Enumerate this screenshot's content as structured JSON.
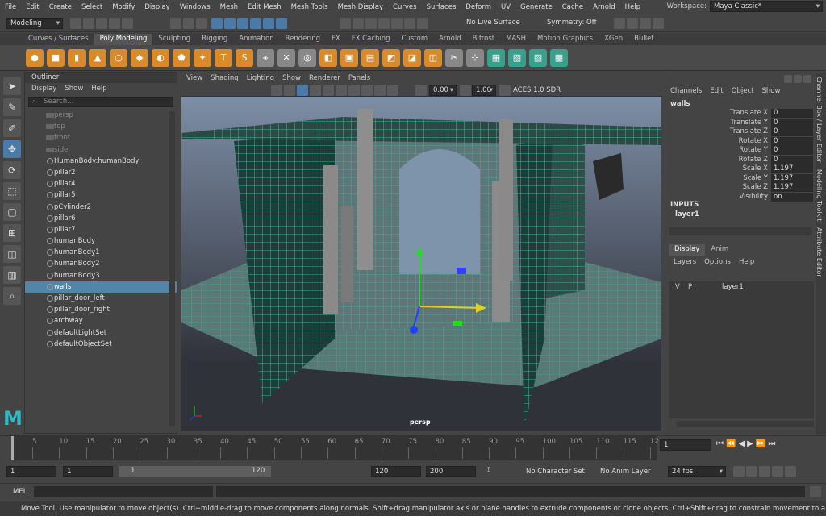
{
  "menubar": {
    "items": [
      "File",
      "Edit",
      "Create",
      "Select",
      "Modify",
      "Display",
      "Windows",
      "Mesh",
      "Edit Mesh",
      "Mesh Tools",
      "Mesh Display",
      "Curves",
      "Surfaces",
      "Deform",
      "UV",
      "Generate",
      "Cache",
      "Arnold",
      "Help"
    ],
    "workspace_label": "Workspace:",
    "workspace_value": "Maya Classic*"
  },
  "statusline": {
    "mode": "Modeling",
    "live_surface": "No Live Surface",
    "symmetry": "Symmetry: Off"
  },
  "shelf": {
    "tabs": [
      "Curves / Surfaces",
      "Poly Modeling",
      "Sculpting",
      "Rigging",
      "Animation",
      "Rendering",
      "FX",
      "FX Caching",
      "Custom",
      "Arnold",
      "Bifrost",
      "MASH",
      "Motion Graphics",
      "XGen",
      "Bullet"
    ],
    "active": "Poly Modeling"
  },
  "outliner": {
    "title": "Outliner",
    "menus": [
      "Display",
      "Show",
      "Help"
    ],
    "search_placeholder": "Search...",
    "items": [
      {
        "label": "persp",
        "type": "camera",
        "dim": true
      },
      {
        "label": "top",
        "type": "camera",
        "dim": true
      },
      {
        "label": "front",
        "type": "camera",
        "dim": true
      },
      {
        "label": "side",
        "type": "camera",
        "dim": true
      },
      {
        "label": "HumanBody:humanBody",
        "type": "mesh"
      },
      {
        "label": "pillar2",
        "type": "mesh"
      },
      {
        "label": "pillar4",
        "type": "mesh"
      },
      {
        "label": "pillar5",
        "type": "mesh"
      },
      {
        "label": "pCylinder2",
        "type": "mesh"
      },
      {
        "label": "pillar6",
        "type": "mesh"
      },
      {
        "label": "pillar7",
        "type": "mesh"
      },
      {
        "label": "humanBody",
        "type": "mesh"
      },
      {
        "label": "humanBody1",
        "type": "mesh"
      },
      {
        "label": "humanBody2",
        "type": "mesh"
      },
      {
        "label": "humanBody3",
        "type": "mesh"
      },
      {
        "label": "walls",
        "type": "mesh",
        "selected": true
      },
      {
        "label": "pillar_door_left",
        "type": "mesh"
      },
      {
        "label": "pillar_door_right",
        "type": "mesh"
      },
      {
        "label": "archway",
        "type": "mesh"
      },
      {
        "label": "defaultLightSet",
        "type": "set"
      },
      {
        "label": "defaultObjectSet",
        "type": "set"
      }
    ]
  },
  "viewport": {
    "menus": [
      "View",
      "Shading",
      "Lighting",
      "Show",
      "Renderer",
      "Panels"
    ],
    "field1": "0.00",
    "field2": "1.00",
    "colorspace": "ACES 1.0 SDR",
    "camera_label": "persp"
  },
  "channelbox": {
    "menus": [
      "Channels",
      "Edit",
      "Object",
      "Show"
    ],
    "object": "walls",
    "attrs": [
      {
        "name": "Translate X",
        "value": "0"
      },
      {
        "name": "Translate Y",
        "value": "0"
      },
      {
        "name": "Translate Z",
        "value": "0"
      },
      {
        "name": "Rotate X",
        "value": "0"
      },
      {
        "name": "Rotate Y",
        "value": "0"
      },
      {
        "name": "Rotate Z",
        "value": "0"
      },
      {
        "name": "Scale X",
        "value": "1.197"
      },
      {
        "name": "Scale Y",
        "value": "1.197"
      },
      {
        "name": "Scale Z",
        "value": "1.197"
      },
      {
        "name": "Visibility",
        "value": "on"
      }
    ],
    "inputs_label": "INPUTS",
    "input_node": "layer1",
    "layer_tabs": [
      "Display",
      "Anim"
    ],
    "layer_menus": [
      "Layers",
      "Options",
      "Help"
    ],
    "layer": {
      "v": "V",
      "p": "P",
      "name": "layer1"
    }
  },
  "side_tabs": [
    "Channel Box / Layer Editor",
    "Modeling Toolkit",
    "Attribute Editor"
  ],
  "timeline": {
    "ticks": [
      "5",
      "10",
      "15",
      "20",
      "25",
      "30",
      "35",
      "40",
      "45",
      "50",
      "55",
      "60",
      "65",
      "70",
      "75",
      "80",
      "85",
      "90",
      "95",
      "100",
      "105",
      "110",
      "115",
      "12"
    ],
    "current_frame": "1"
  },
  "range": {
    "start": "1",
    "anim_start": "1",
    "slider_start": "1",
    "slider_end": "120",
    "end": "120",
    "anim_end": "200",
    "character_set": "No Character Set",
    "anim_layer": "No Anim Layer",
    "fps": "24 fps"
  },
  "cmdline": {
    "label": "MEL"
  },
  "helpline": "Move Tool: Use manipulator to move object(s). Ctrl+middle-drag to move components along normals. Shift+drag manipulator axis or plane handles to extrude components or clone objects. Ctrl+Shift+drag to constrain movement to a connected edge. Use D or HOME to change the pivot"
}
